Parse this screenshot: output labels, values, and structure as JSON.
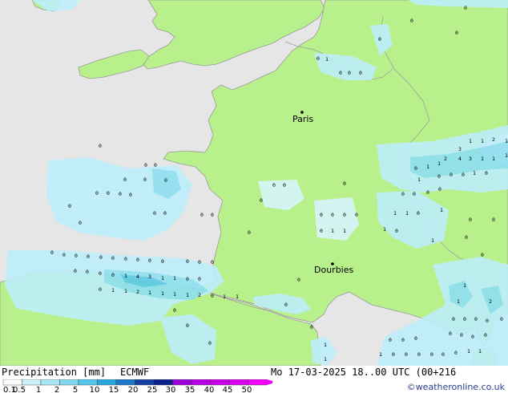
{
  "map": {
    "colors": {
      "sea": "#e6e6e6",
      "land": "#b8f08c",
      "coast": "#9a9a9a",
      "border": "#a0a0a0",
      "precip_light": "#bdeefa",
      "precip_mid": "#8ee0f2",
      "precip_heavy": "#5ccbe6"
    },
    "cities": [
      {
        "name": "Paris"
      },
      {
        "name": "Dourbies"
      }
    ],
    "point_values": [
      "0",
      "1",
      "2",
      "3",
      "4"
    ]
  },
  "footer": {
    "title": "Precipitation [mm]",
    "model": "ECMWF",
    "datetime": "Mo 17-03-2025 18..00 UTC (00+216",
    "credit": "©weatheronline.co.uk"
  },
  "legend": {
    "ticks": [
      "0.1",
      "0.5",
      "1",
      "2",
      "5",
      "10",
      "15",
      "20",
      "25",
      "30",
      "35",
      "40",
      "45",
      "50"
    ],
    "colors": [
      "#ffffff",
      "#cdf0fa",
      "#a8e6f6",
      "#7fd6ee",
      "#52c6e6",
      "#2aa4dc",
      "#1c78c8",
      "#1440a8",
      "#0c208c",
      "#a000d8",
      "#b400e0",
      "#c800e8",
      "#dc00f0",
      "#f000f8"
    ]
  }
}
